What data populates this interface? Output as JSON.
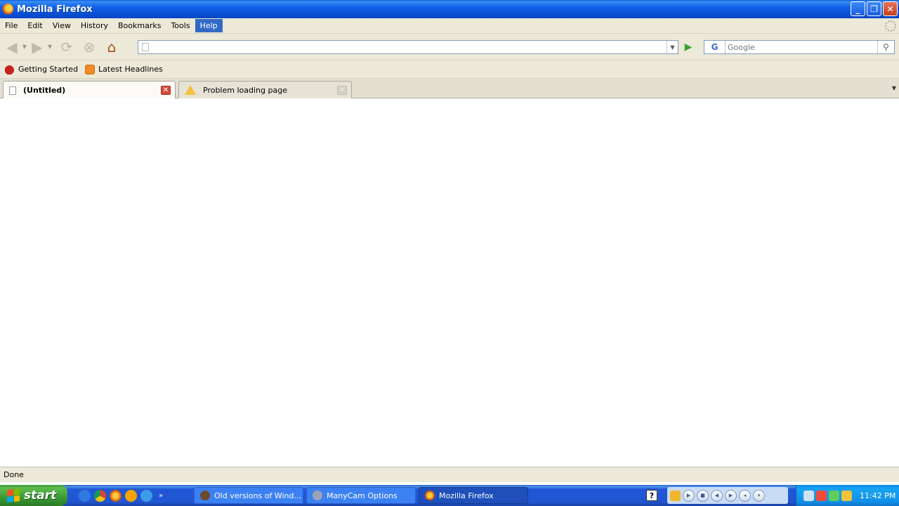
{
  "window": {
    "title": "Mozilla Firefox",
    "controls": {
      "minimize": "_",
      "maximize": "❐",
      "close": "✕"
    }
  },
  "menubar": {
    "items": [
      "File",
      "Edit",
      "View",
      "History",
      "Bookmarks",
      "Tools",
      "Help"
    ],
    "active": "Help"
  },
  "navbar": {
    "url_value": "",
    "search_placeholder": "Google",
    "search_engine": "G"
  },
  "bookmarks": {
    "items": [
      {
        "label": "Getting Started",
        "icon": "getting-started-icon"
      },
      {
        "label": "Latest Headlines",
        "icon": "rss-icon"
      }
    ]
  },
  "tabs": [
    {
      "label": "(Untitled)",
      "selected": true,
      "icon": "blank-page-icon"
    },
    {
      "label": "Problem loading page",
      "selected": false,
      "icon": "warning-icon"
    }
  ],
  "status": {
    "text": "Done"
  },
  "taskbar": {
    "start_label": "start",
    "buttons": [
      {
        "label": "Old versions of Wind...",
        "active": false
      },
      {
        "label": "ManyCam Options",
        "active": false
      },
      {
        "label": "Mozilla Firefox",
        "active": true
      }
    ],
    "clock": "11:42 PM"
  },
  "colors": {
    "titlebar": "#0a52d8",
    "menubar_bg": "#ece9d8",
    "menu_highlight": "#316ac5",
    "taskbar": "#2156d1",
    "start_button": "#389a33",
    "tray": "#1190e8"
  }
}
